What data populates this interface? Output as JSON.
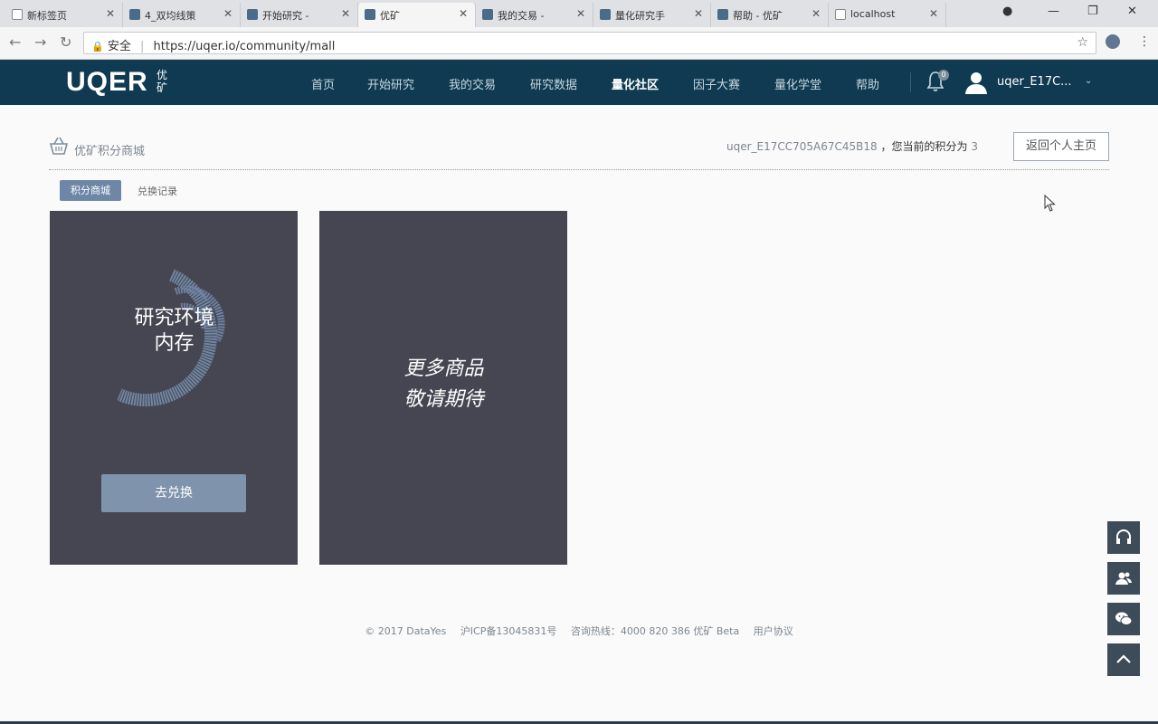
{
  "browser": {
    "tabs": [
      {
        "label": "新标签页"
      },
      {
        "label": "4_双均线策"
      },
      {
        "label": "开始研究 -"
      },
      {
        "label": "优矿"
      },
      {
        "label": "我的交易 -"
      },
      {
        "label": "量化研究手"
      },
      {
        "label": "帮助 - 优矿"
      },
      {
        "label": "localhost"
      }
    ],
    "address": {
      "secure_label": "安全",
      "url": "https://uqer.io/community/mall"
    }
  },
  "header": {
    "logo": "UQER",
    "logo_cn": "优矿",
    "nav": [
      "首页",
      "开始研究",
      "我的交易",
      "研究数据",
      "量化社区",
      "因子大赛",
      "量化学堂",
      "帮助"
    ],
    "active_nav": "量化社区",
    "notification_count": "0",
    "username": "uqer_E17C..."
  },
  "mall": {
    "title": "优矿积分商城",
    "user_id": "uqer_E17CC705A67C45B18",
    "points_label": "，您当前的积分为",
    "points_value": "3",
    "back_button": "返回个人主页",
    "tabs": {
      "active": "积分商城",
      "inactive": "兑换记录"
    },
    "cards": [
      {
        "line1": "研究环境",
        "line2": "内存",
        "button": "去兑换"
      },
      {
        "line1": "更多商品",
        "line2": "敬请期待"
      }
    ]
  },
  "footer": {
    "copyright": "© 2017 DataYes",
    "icp": "沪ICP备13045831号",
    "hotline": "咨询热线：4000 820 386 优矿 Beta",
    "agreement": "用户协议"
  },
  "colors": {
    "header_bg": "#0f3a52",
    "card_bg": "#454652",
    "accent": "#6e87a6"
  }
}
